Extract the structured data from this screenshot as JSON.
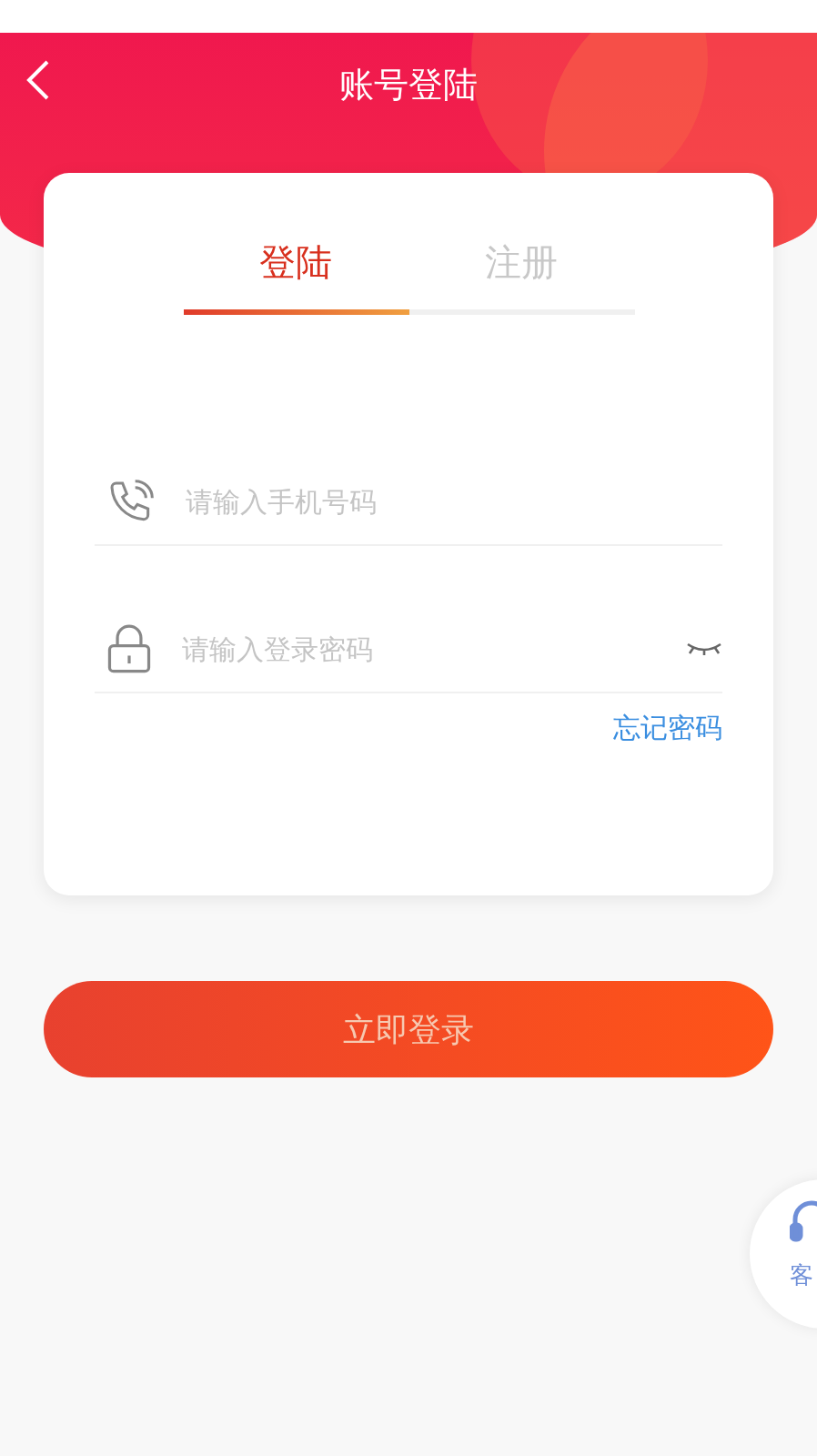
{
  "header": {
    "title": "账号登陆"
  },
  "tabs": [
    {
      "label": "登陆",
      "selected": true
    },
    {
      "label": "注册",
      "selected": false
    }
  ],
  "fields": [
    {
      "kind": "phone",
      "placeholder": "请输入手机号码"
    },
    {
      "kind": "password",
      "placeholder": "请输入登录密码"
    }
  ],
  "forgot_link": "忘记密码",
  "submit_button": "立即登录",
  "service_button": {
    "label": "客"
  }
}
